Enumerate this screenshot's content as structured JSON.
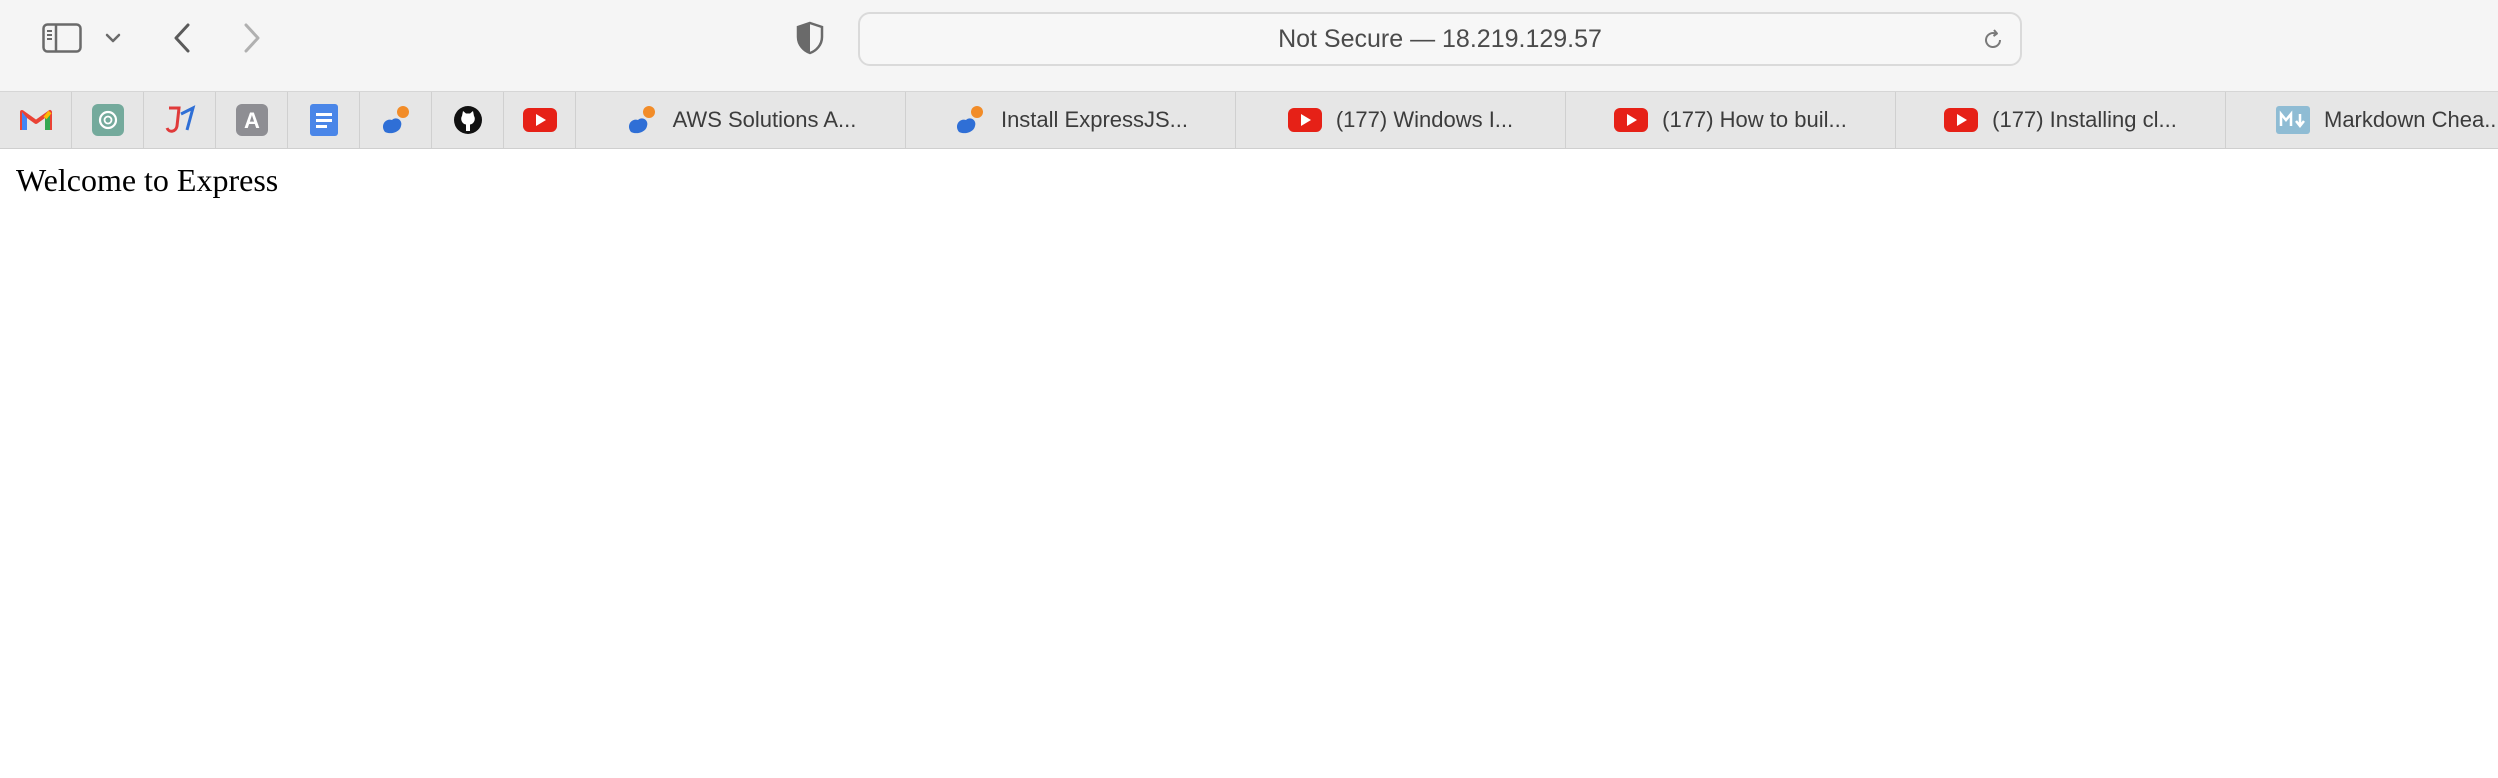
{
  "browser": {
    "address": "Not Secure — 18.219.129.57"
  },
  "favorites_icons": [
    {
      "name": "gmail-icon"
    },
    {
      "name": "chatgpt-icon"
    },
    {
      "name": "jira-icon"
    },
    {
      "name": "app-a-icon"
    },
    {
      "name": "google-docs-icon"
    },
    {
      "name": "cloud-tab-icon"
    },
    {
      "name": "github-icon"
    },
    {
      "name": "youtube-icon"
    }
  ],
  "favorites_tabs": [
    {
      "label": "AWS Solutions A...",
      "icon": "cloud-tab-icon"
    },
    {
      "label": "Install ExpressJS...",
      "icon": "cloud-tab-icon"
    },
    {
      "label": "(177) Windows I...",
      "icon": "youtube-icon"
    },
    {
      "label": "(177) How to buil...",
      "icon": "youtube-icon"
    },
    {
      "label": "(177) Installing cl...",
      "icon": "youtube-icon"
    },
    {
      "label": "Markdown Chea...",
      "icon": "markdown-icon"
    }
  ],
  "page": {
    "body_text": "Welcome to Express"
  },
  "colors": {
    "youtube": "#e62117",
    "gmail_red": "#ea4335",
    "docs_blue": "#4a86e8",
    "chatgpt_green": "#74aa9c",
    "cloud_blue": "#2f6fd6",
    "cloud_orange": "#f28c28"
  }
}
